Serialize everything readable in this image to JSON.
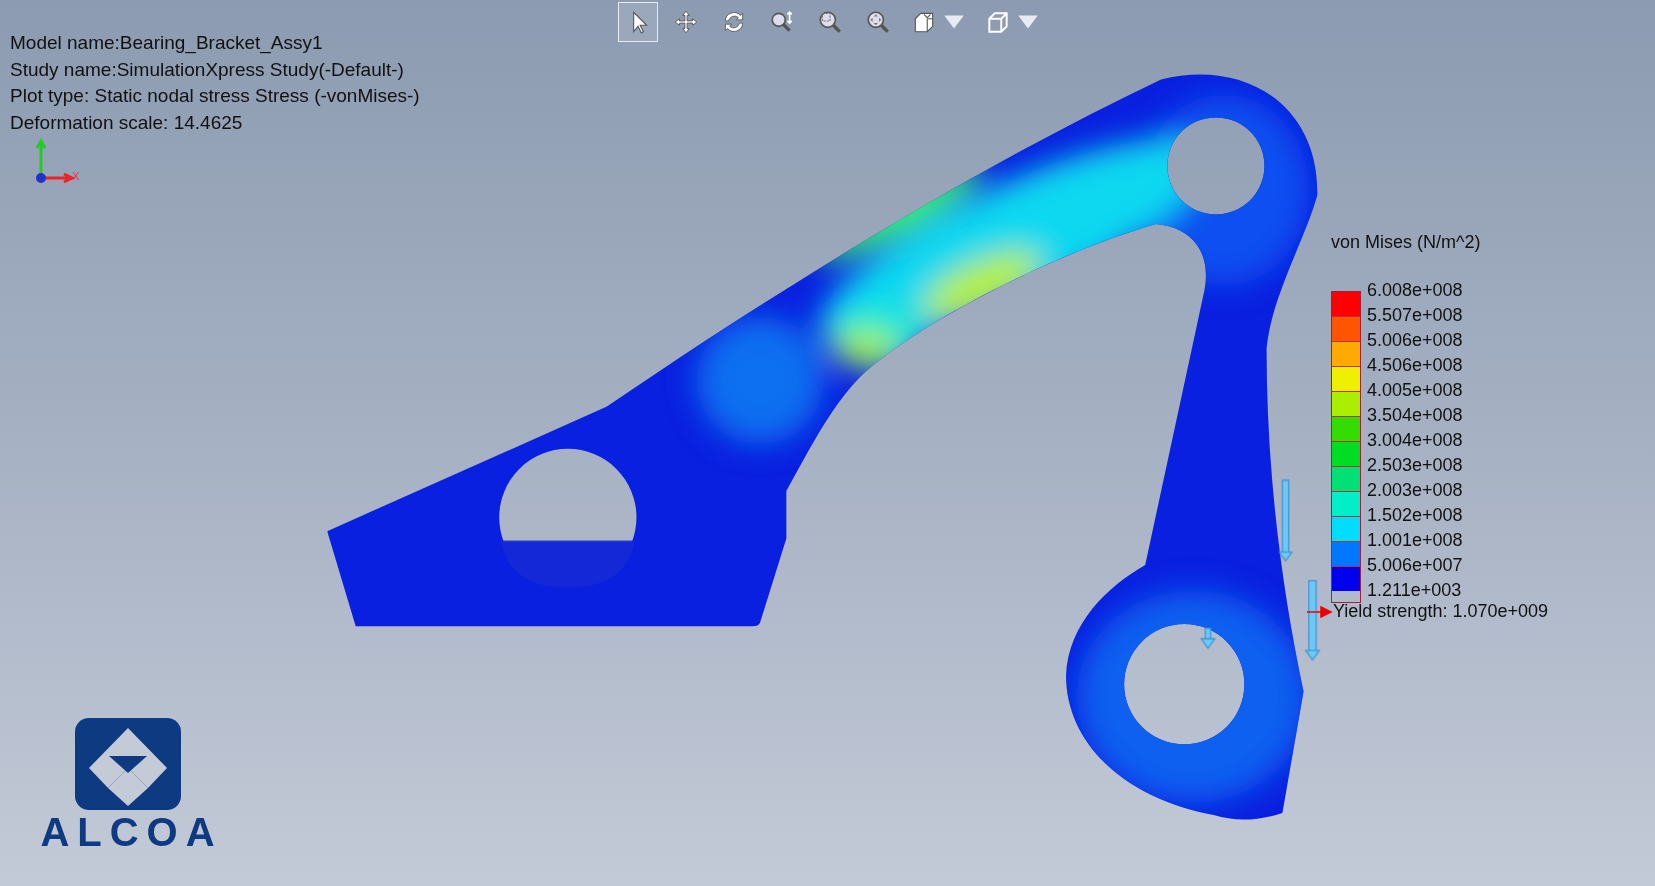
{
  "toolbar": {
    "tools": [
      {
        "selected": true,
        "dropdown": false
      },
      {
        "selected": false,
        "dropdown": false
      },
      {
        "selected": false,
        "dropdown": false
      },
      {
        "selected": false,
        "dropdown": false
      },
      {
        "selected": false,
        "dropdown": false
      },
      {
        "selected": false,
        "dropdown": false
      },
      {
        "selected": false,
        "dropdown": true
      },
      {
        "selected": false,
        "dropdown": true
      }
    ]
  },
  "info": [
    "Model name:Bearing_Bracket_Assy1",
    "Study name:SimulationXpress Study(-Default-)",
    "Plot type: Static nodal stress Stress (-vonMises-)",
    "Deformation scale: 14.4625"
  ],
  "axis_triad": {
    "x_label": "X"
  },
  "legend": {
    "title": "von Mises (N/m^2)",
    "segments": [
      {
        "color": "#ff0000"
      },
      {
        "color": "#ff5500"
      },
      {
        "color": "#ffaa00"
      },
      {
        "color": "#eef000"
      },
      {
        "color": "#aaee00"
      },
      {
        "color": "#33dd00"
      },
      {
        "color": "#00dd22"
      },
      {
        "color": "#00e077"
      },
      {
        "color": "#00eec8"
      },
      {
        "color": "#00ddff"
      },
      {
        "color": "#0077ff"
      },
      {
        "color": "#0000ee"
      }
    ],
    "labels": [
      "6.008e+008",
      "5.507e+008",
      "5.006e+008",
      "4.506e+008",
      "4.005e+008",
      "3.504e+008",
      "3.004e+008",
      "2.503e+008",
      "2.003e+008",
      "1.502e+008",
      "1.001e+008",
      "5.006e+007",
      "1.211e+003"
    ],
    "yield": "Yield strength: 1.070e+009"
  },
  "logo": {
    "text": "ALCOA"
  }
}
